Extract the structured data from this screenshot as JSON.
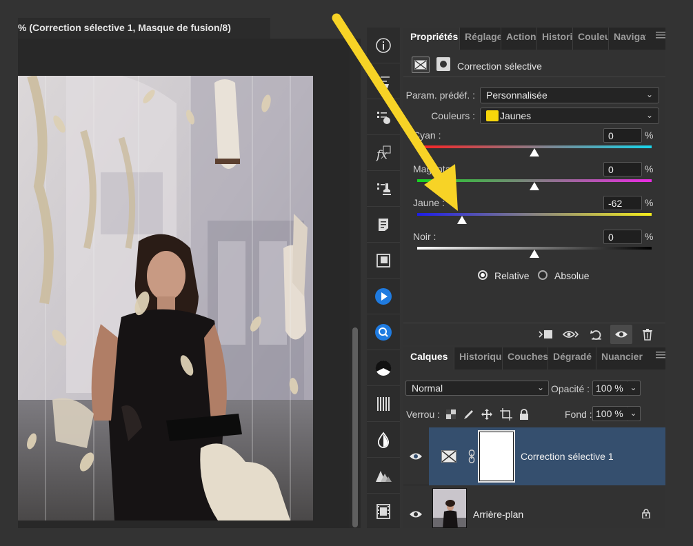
{
  "document": {
    "tab_title": "% (Correction sélective 1, Masque de fusion/8)"
  },
  "properties_panel": {
    "tabs": [
      {
        "label": "Propriétés",
        "active": true
      },
      {
        "label": "Réglages"
      },
      {
        "label": "Actions"
      },
      {
        "label": "Historique"
      },
      {
        "label": "Couleurs"
      },
      {
        "label": "Navigation"
      }
    ],
    "menu_icon": "hamburger-menu-icon",
    "adjustment_title": "Correction sélective",
    "preset_label": "Param. prédéf. :",
    "preset_value": "Personnalisée",
    "colors_label": "Couleurs :",
    "colors_value": "Jaunes",
    "colors_swatch": "#f7d60b",
    "sliders": [
      {
        "label": "Cyan :",
        "value": "0",
        "unit": "%",
        "gradient": [
          "#ff2020",
          "#18d6ec"
        ],
        "level": 0
      },
      {
        "label": "Magenta :",
        "value": "0",
        "unit": "%",
        "gradient": [
          "#18d321",
          "#ea2be3"
        ],
        "level": 0
      },
      {
        "label": "Jaune :",
        "value": "-62",
        "unit": "%",
        "gradient": [
          "#1d1de8",
          "#f4ec1c"
        ],
        "level": -62
      },
      {
        "label": "Noir :",
        "value": "0",
        "unit": "%",
        "gradient": [
          "#ffffff",
          "#000000"
        ],
        "level": 0
      }
    ],
    "method": {
      "relative_label": "Relative",
      "absolute_label": "Absolue",
      "selected": "Relative"
    }
  },
  "layers_panel": {
    "tabs": [
      {
        "label": "Calques",
        "active": true
      },
      {
        "label": "Historique"
      },
      {
        "label": "Couches"
      },
      {
        "label": "Dégradé"
      },
      {
        "label": "Nuancier"
      }
    ],
    "blend_mode": "Normal",
    "opacity_label": "Opacité :",
    "opacity_value": "100 %",
    "lock_label": "Verrou :",
    "fill_label": "Fond :",
    "fill_value": "100 %",
    "layers": [
      {
        "name": "Correction sélective 1",
        "selected": true
      },
      {
        "name": "Arrière-plan",
        "locked": true
      }
    ]
  },
  "colors": {
    "accent_selection": "#354f6e",
    "annotation_arrow": "#f7d326",
    "panel_bg": "#323232"
  }
}
